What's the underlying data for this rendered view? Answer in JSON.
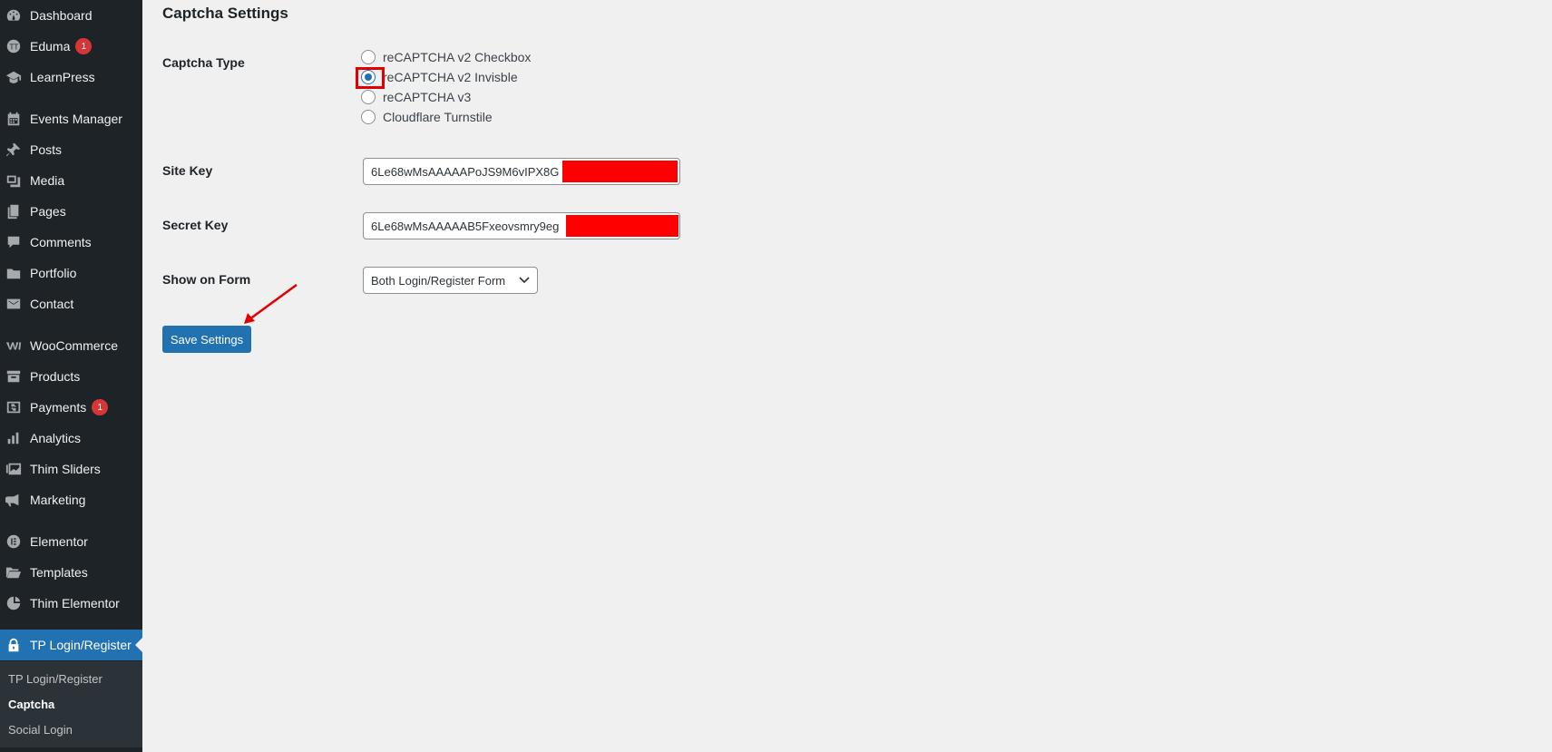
{
  "sidebar": {
    "items": [
      {
        "label": "Dashboard",
        "icon": "dashboard-icon"
      },
      {
        "label": "Eduma",
        "icon": "eduma-icon",
        "badge": "1"
      },
      {
        "label": "LearnPress",
        "icon": "learnpress-icon"
      },
      {
        "label": "Events Manager",
        "icon": "calendar-icon"
      },
      {
        "label": "Posts",
        "icon": "pin-icon"
      },
      {
        "label": "Media",
        "icon": "media-icon"
      },
      {
        "label": "Pages",
        "icon": "pages-icon"
      },
      {
        "label": "Comments",
        "icon": "comment-icon"
      },
      {
        "label": "Portfolio",
        "icon": "folder-icon"
      },
      {
        "label": "Contact",
        "icon": "mail-icon"
      },
      {
        "label": "WooCommerce",
        "icon": "woocommerce-icon"
      },
      {
        "label": "Products",
        "icon": "archive-icon"
      },
      {
        "label": "Payments",
        "icon": "dollar-icon",
        "badge": "1"
      },
      {
        "label": "Analytics",
        "icon": "bar-chart-icon"
      },
      {
        "label": "Thim Sliders",
        "icon": "slides-icon"
      },
      {
        "label": "Marketing",
        "icon": "megaphone-icon"
      },
      {
        "label": "Elementor",
        "icon": "elementor-icon"
      },
      {
        "label": "Templates",
        "icon": "folder-open-icon"
      },
      {
        "label": "Thim Elementor",
        "icon": "thim-icon"
      },
      {
        "label": "TP Login/Register",
        "icon": "lock-icon",
        "active": true
      }
    ],
    "submenu": [
      {
        "label": "TP Login/Register"
      },
      {
        "label": "Captcha",
        "current": true
      },
      {
        "label": "Social Login"
      }
    ]
  },
  "main": {
    "title": "Captcha Settings",
    "captcha_type": {
      "label": "Captcha Type",
      "options": [
        {
          "label": "reCAPTCHA v2 Checkbox",
          "checked": false
        },
        {
          "label": "reCAPTCHA v2 Invisble",
          "checked": true
        },
        {
          "label": "reCAPTCHA v3",
          "checked": false
        },
        {
          "label": "Cloudflare Turnstile",
          "checked": false
        }
      ]
    },
    "site_key": {
      "label": "Site Key",
      "value": "6Le68wMsAAAAAPoJS9M6vIPX8G"
    },
    "secret_key": {
      "label": "Secret Key",
      "value": "6Le68wMsAAAAAB5Fxeovsmry9eg"
    },
    "show_on_form": {
      "label": "Show on Form",
      "selected": "Both Login/Register Form"
    },
    "save_label": "Save Settings"
  },
  "colors": {
    "sidebar_bg": "#1d2327",
    "active_bg": "#2271b1",
    "badge": "#d63638",
    "annotation": "#e00000",
    "redaction": "#ff0000"
  }
}
